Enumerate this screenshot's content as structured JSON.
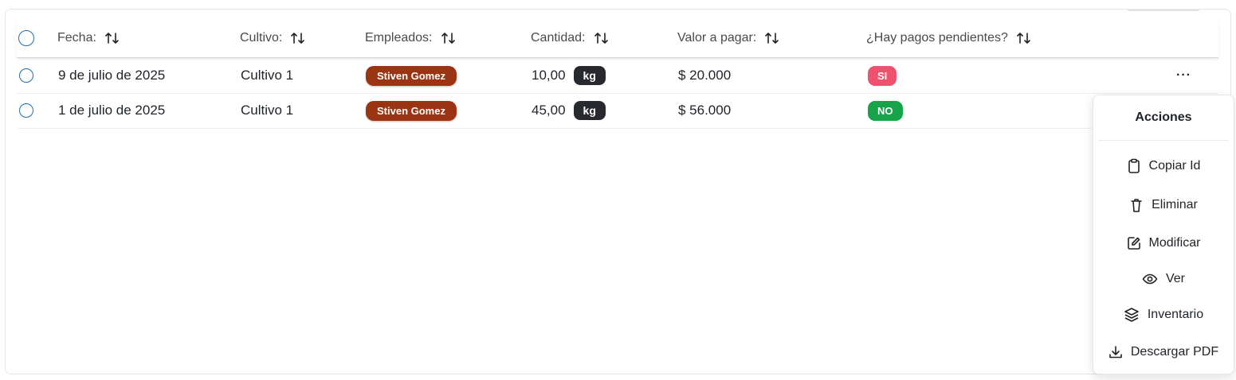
{
  "table": {
    "headers": {
      "fecha": "Fecha:",
      "cultivo": "Cultivo:",
      "empleados": "Empleados:",
      "cantidad": "Cantidad:",
      "valor": "Valor a pagar:",
      "pendientes": "¿Hay pagos pendientes?"
    },
    "rows": [
      {
        "fecha": "9 de julio de 2025",
        "cultivo": "Cultivo 1",
        "empleado": "Stiven Gomez",
        "cantidad": "10,00",
        "unidad": "kg",
        "valor": "$ 20.000",
        "pendiente": "SI"
      },
      {
        "fecha": "1 de julio de 2025",
        "cultivo": "Cultivo 1",
        "empleado": "Stiven Gomez",
        "cantidad": "45,00",
        "unidad": "kg",
        "valor": "$ 56.000",
        "pendiente": "NO"
      }
    ],
    "more_label": "···"
  },
  "menu": {
    "title": "Acciones",
    "items": [
      {
        "label": "Copiar Id",
        "icon": "clipboard-icon"
      },
      {
        "label": "Eliminar",
        "icon": "trash-icon"
      },
      {
        "label": "Modificar",
        "icon": "edit-icon"
      },
      {
        "label": "Ver",
        "icon": "eye-icon"
      },
      {
        "label": "Inventario",
        "icon": "layers-icon"
      },
      {
        "label": "Descargar PDF",
        "icon": "download-icon"
      }
    ]
  },
  "colors": {
    "employee_badge": "#9a3412",
    "unit_badge": "#27292e",
    "pending_yes": "#f0516e",
    "pending_no": "#16a34a",
    "radio_border": "#1e6fb0"
  }
}
